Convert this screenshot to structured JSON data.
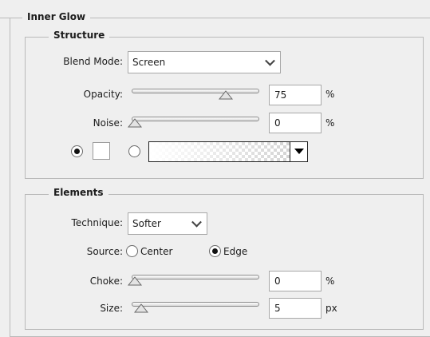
{
  "panel": {
    "title": "Inner Glow"
  },
  "structure": {
    "legend": "Structure",
    "blend_mode_label": "Blend Mode:",
    "blend_mode_value": "Screen",
    "opacity_label": "Opacity:",
    "opacity_value": "75",
    "opacity_unit": "%",
    "opacity_level": 0.75,
    "noise_label": "Noise:",
    "noise_value": "0",
    "noise_unit": "%",
    "noise_level": 0.0,
    "color_mode": "solid-color",
    "solid_color": "#ffffff"
  },
  "elements": {
    "legend": "Elements",
    "technique_label": "Technique:",
    "technique_value": "Softer",
    "source_label": "Source:",
    "source_options": [
      "Center",
      "Edge"
    ],
    "source_selected": "Edge",
    "choke_label": "Choke:",
    "choke_value": "0",
    "choke_unit": "%",
    "choke_level": 0.0,
    "size_label": "Size:",
    "size_value": "5",
    "size_unit": "px",
    "size_level": 0.05
  }
}
